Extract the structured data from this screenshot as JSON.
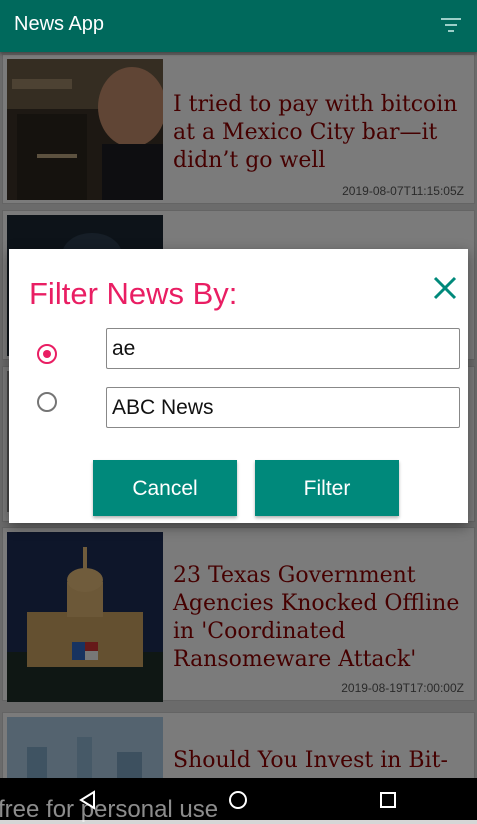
{
  "app": {
    "title": "News App",
    "filter_icon": "filter-list-icon"
  },
  "articles": [
    {
      "headline": "I tried to pay with bitcoin at a Mexico City bar—it didn’t go well",
      "date": "2019-08-07T11:15:05Z"
    },
    {
      "headline": "",
      "date": ""
    },
    {
      "headline": "",
      "date": ""
    },
    {
      "headline": "23 Texas Government Agencies Knocked Offline in 'Coordinated Ransomeware Attack'",
      "date": "2019-08-19T17:00:00Z"
    },
    {
      "headline": "Should You Invest in Bit-",
      "date": ""
    }
  ],
  "dialog": {
    "title": "Filter News By:",
    "close_icon": "close-icon",
    "options": [
      {
        "value": "ae",
        "selected": true
      },
      {
        "value": "ABC News",
        "selected": false
      }
    ],
    "cancel_label": "Cancel",
    "filter_label": "Filter"
  },
  "navbar": {
    "back_icon": "back-icon",
    "home_icon": "home-icon",
    "recents_icon": "recents-icon"
  },
  "watermark": "free for personal use",
  "colors": {
    "appbar": "#00695c",
    "accent": "#e91e63",
    "button": "#00897b",
    "headline": "#8b0000"
  }
}
